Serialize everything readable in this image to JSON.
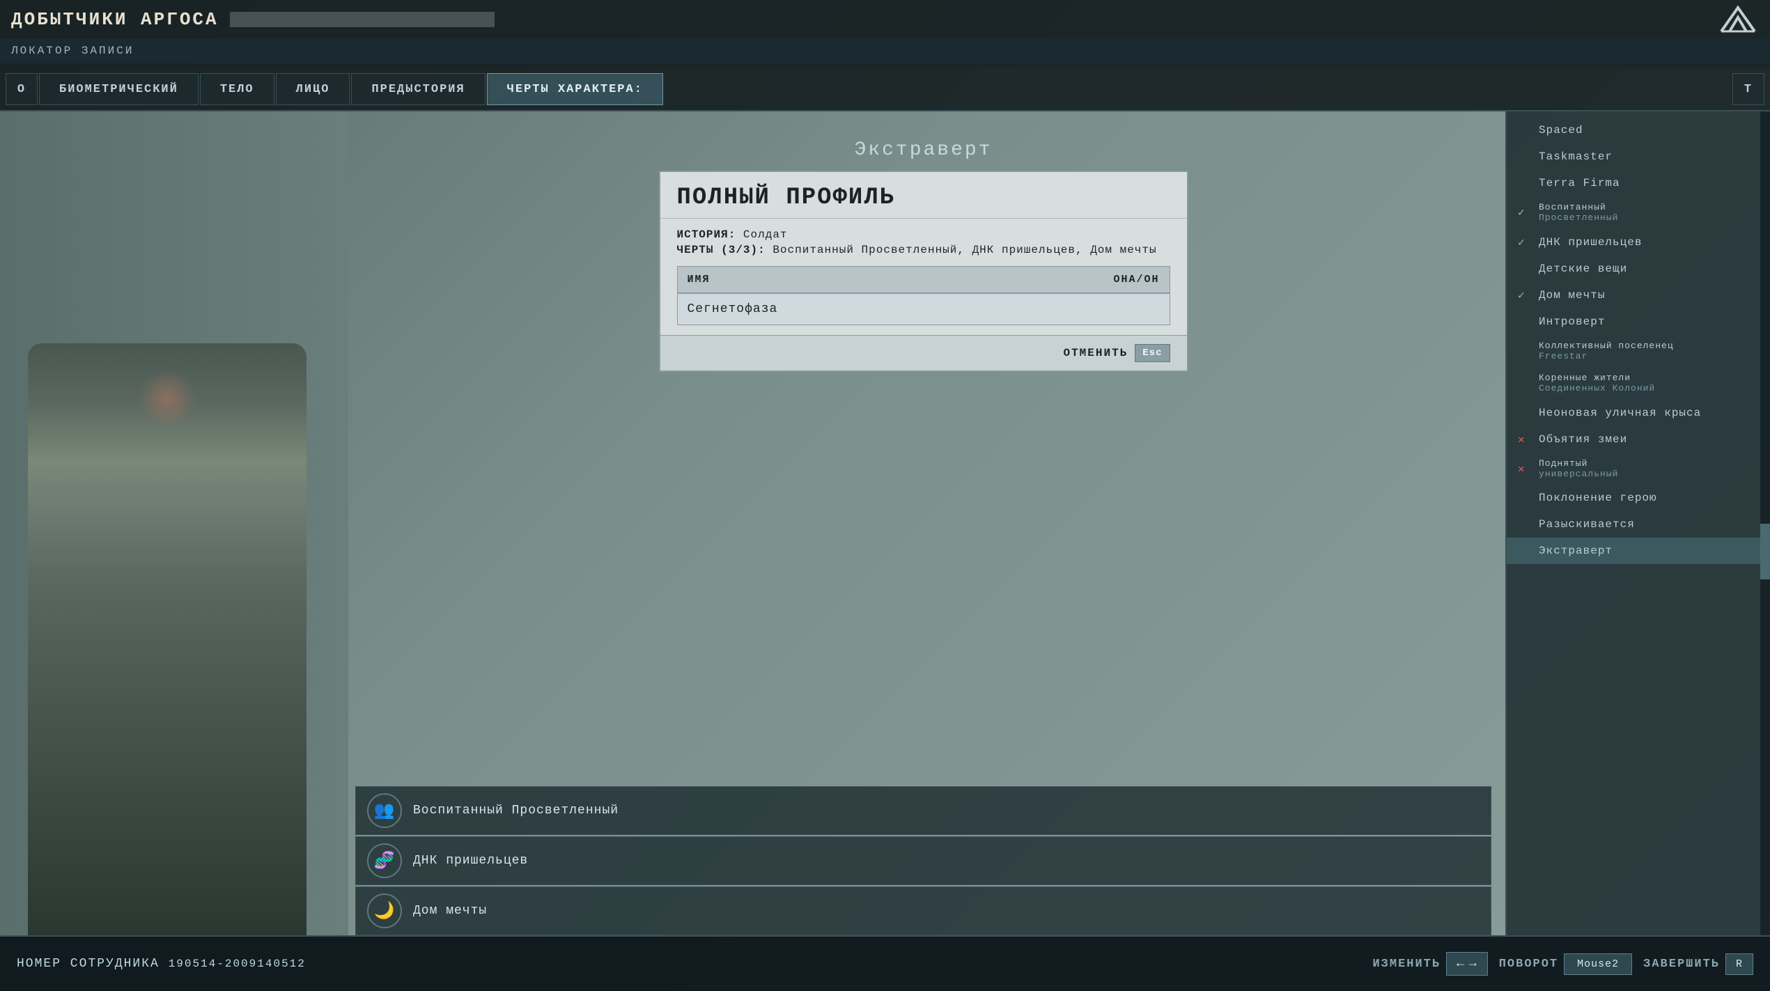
{
  "header": {
    "title": "ДОБЫТЧИКИ АРГОСА",
    "subtitle": "ЛОКАТОР ЗАПИСИ",
    "logo_alt": "AE logo"
  },
  "nav": {
    "tabs": [
      {
        "id": "o",
        "label": "O",
        "small": true
      },
      {
        "id": "biometric",
        "label": "БИОМЕТРИЧЕСКИЙ"
      },
      {
        "id": "body",
        "label": "ТЕЛО"
      },
      {
        "id": "face",
        "label": "ЛИЦО"
      },
      {
        "id": "history",
        "label": "ПРЕДЫСТОРИЯ"
      },
      {
        "id": "traits",
        "label": "ЧЕРТЫ ХАРАКТЕРА:",
        "active": true
      },
      {
        "id": "t",
        "label": "T",
        "small": true
      }
    ]
  },
  "modal": {
    "title": "ПОЛНЫЙ ПРОФИЛЬ",
    "history_label": "ИСТОРИЯ:",
    "history_value": "Солдат",
    "traits_label": "ЧЕРТЫ (3/3):",
    "traits_value": "Воспитанный Просветленный, ДНК пришельцев, Дом мечты",
    "table": {
      "col_name": "ИМЯ",
      "col_pronoun": "ОНА/ОН",
      "name_value": "Сегнетофаза"
    },
    "cancel_button": "ОТМЕНИТЬ",
    "cancel_key": "Esc"
  },
  "trait_title": "Экстраверт",
  "traits_list": [
    {
      "name": "Воспитанный Просветленный",
      "icon": "👥"
    },
    {
      "name": "ДНК пришельцев",
      "icon": "🧬"
    },
    {
      "name": "Дом мечты",
      "icon": "🌙"
    }
  ],
  "sidebar": {
    "items": [
      {
        "label": "Spaced",
        "status": "none"
      },
      {
        "label": "Taskmaster",
        "status": "none"
      },
      {
        "label": "Terra Firma",
        "status": "none"
      },
      {
        "label": "Воспитанный",
        "sublabel": "Просветленный",
        "status": "checked"
      },
      {
        "label": "ДНК пришельцев",
        "status": "checked"
      },
      {
        "label": "Детские вещи",
        "status": "none"
      },
      {
        "label": "Дом мечты",
        "status": "checked"
      },
      {
        "label": "Интроверт",
        "status": "none"
      },
      {
        "label": "Коллективный поселенец",
        "sublabel": "Freestar",
        "status": "none"
      },
      {
        "label": "Коренные жители",
        "sublabel": "Соединенных Колоний",
        "status": "none"
      },
      {
        "label": "Неоновая уличная крыса",
        "status": "none"
      },
      {
        "label": "Объятия змеи",
        "status": "crossed"
      },
      {
        "label": "Поднятый",
        "sublabel": "универсальный",
        "status": "crossed"
      },
      {
        "label": "Поклонение герою",
        "status": "none"
      },
      {
        "label": "Разыскивается",
        "status": "none"
      },
      {
        "label": "Экстраверт",
        "status": "selected"
      }
    ]
  },
  "status_bar": {
    "employee_label": "НОМЕР СОТРУДНИКА",
    "employee_id": "190514-2009140512",
    "change_label": "ИЗМЕНИТЬ",
    "change_key_left": "←",
    "change_key_right": "→",
    "rotation_label": "ПОВОРОТ",
    "rotation_key": "Mouse2",
    "finish_label": "ЗАВЕРШИТЬ",
    "finish_key": "R"
  }
}
